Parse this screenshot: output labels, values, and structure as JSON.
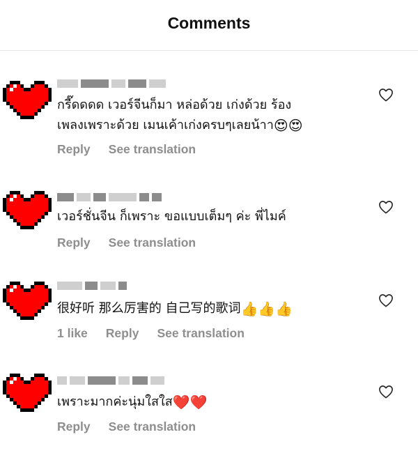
{
  "header": {
    "title": "Comments"
  },
  "comments": [
    {
      "text_line1": "กรี๊ดดดด เวอร์จีนก็มา หล่อด้วย เก่งด้วย ร้อง",
      "text_line2": "เพลงเพราะด้วย เมนเค้าเก่งครบๆเลยน้าา",
      "emoji": "😍😍",
      "likes": "",
      "reply_label": "Reply",
      "translate_label": "See translation"
    },
    {
      "text_line1": "เวอร์ชั่นจีน ก็เพราะ ขอแบบเต็มๆ ค่ะ พี่ไมค์",
      "text_line2": "",
      "emoji": "",
      "likes": "",
      "reply_label": "Reply",
      "translate_label": "See translation"
    },
    {
      "text_line1": "很好听 那么厉害的  自己写的歌词",
      "text_line2": "",
      "emoji": "👍👍👍",
      "likes": "1 like",
      "reply_label": "Reply",
      "translate_label": "See translation"
    },
    {
      "text_line1": "เพราะมากค่ะนุ่มใสใส",
      "text_line2": "",
      "emoji": "❤️❤️",
      "likes": "",
      "reply_label": "Reply",
      "translate_label": "See translation"
    }
  ],
  "icons": {
    "avatar": "pixel-heart-icon",
    "like": "heart-outline-icon"
  },
  "colors": {
    "avatar_red": "#ff0000",
    "secondary_text": "#8e8e8e",
    "divider": "#e6e6e6"
  }
}
